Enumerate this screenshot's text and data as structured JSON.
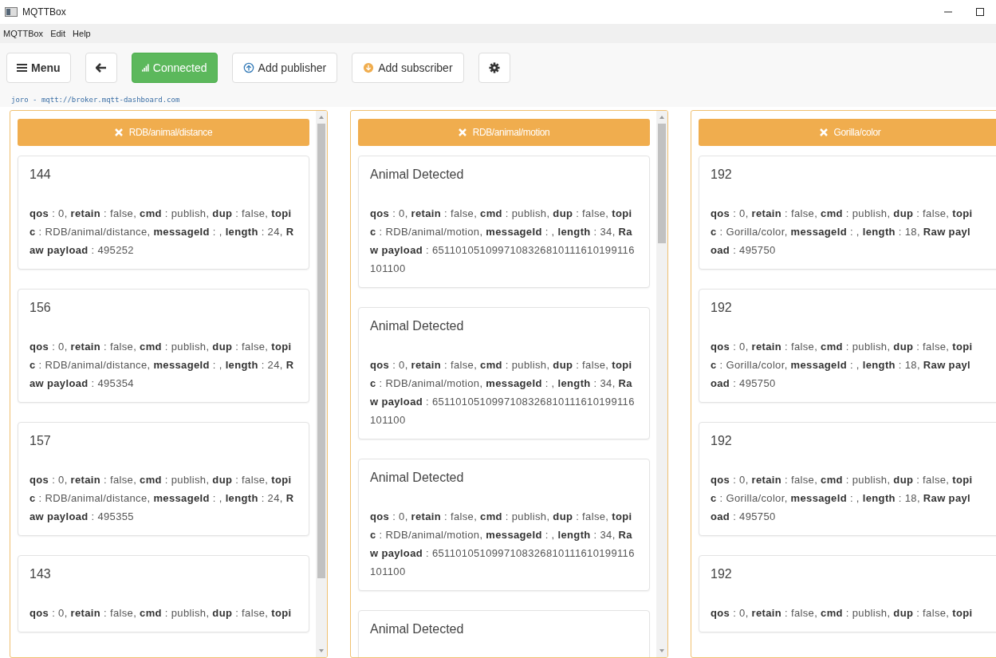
{
  "window": {
    "title": "MQTTBox"
  },
  "menu_bar": [
    "MQTTBox",
    "Edit",
    "Help"
  ],
  "toolbar": {
    "menu_label": "Menu",
    "status": {
      "label": "Connected",
      "connected": true
    },
    "add_publisher": "Add publisher",
    "add_subscriber": "Add subscriber"
  },
  "connection": "joro - mqtt://broker.mqtt-dashboard.com",
  "subscribers": [
    {
      "topic": "RDB/animal/distance",
      "scrollbar": true,
      "messages": [
        {
          "value": "144",
          "meta": "**qos** : 0, **retain** : false, **cmd** : publish, **dup** : false, **topic** : RDB/animal/distance, **messageId** : , **length** : 24, **Raw payload** : 495252"
        },
        {
          "value": "156",
          "meta": "**qos** : 0, **retain** : false, **cmd** : publish, **dup** : false, **topic** : RDB/animal/distance, **messageId** : , **length** : 24, **Raw payload** : 495354"
        },
        {
          "value": "157",
          "meta": "**qos** : 0, **retain** : false, **cmd** : publish, **dup** : false, **topic** : RDB/animal/distance, **messageId** : , **length** : 24, **Raw payload** : 495355"
        },
        {
          "value": "143",
          "meta": "**qos** : 0, **retain** : false, **cmd** : publish, **dup** : false, **topi**"
        }
      ]
    },
    {
      "topic": "RDB/animal/motion",
      "scrollbar": true,
      "messages": [
        {
          "value": "Animal Detected",
          "meta": "**qos** : 0, **retain** : false, **cmd** : publish, **dup** : false, **topic** : RDB/animal/motion, **messageId** : , **length** : 34, **Raw payload** : 6511010510997108326810111610199116101100"
        },
        {
          "value": "Animal Detected",
          "meta": "**qos** : 0, **retain** : false, **cmd** : publish, **dup** : false, **topic** : RDB/animal/motion, **messageId** : , **length** : 34, **Raw payload** : 6511010510997108326810111610199116101100"
        },
        {
          "value": "Animal Detected",
          "meta": "**qos** : 0, **retain** : false, **cmd** : publish, **dup** : false, **topic** : RDB/animal/motion, **messageId** : , **length** : 34, **Raw payload** : 6511010510997108326810111610199116101100"
        },
        {
          "value": "Animal Detected"
        }
      ]
    },
    {
      "topic": "Gorilla/color",
      "scrollbar": false,
      "messages": [
        {
          "value": "192",
          "meta": "**qos** : 0, **retain** : false, **cmd** : publish, **dup** : false, **topic** : Gorilla/color, **messageId** : , **length** : 18, **Raw payload** : 495750"
        },
        {
          "value": "192",
          "meta": "**qos** : 0, **retain** : false, **cmd** : publish, **dup** : false, **topic** : Gorilla/color, **messageId** : , **length** : 18, **Raw payload** : 495750"
        },
        {
          "value": "192",
          "meta": "**qos** : 0, **retain** : false, **cmd** : publish, **dup** : false, **topic** : Gorilla/color, **messageId** : , **length** : 18, **Raw payload** : 495750"
        },
        {
          "value": "192",
          "meta": "**qos** : 0, **retain** : false, **cmd** : publish, **dup** : false, **topi**"
        }
      ]
    }
  ]
}
